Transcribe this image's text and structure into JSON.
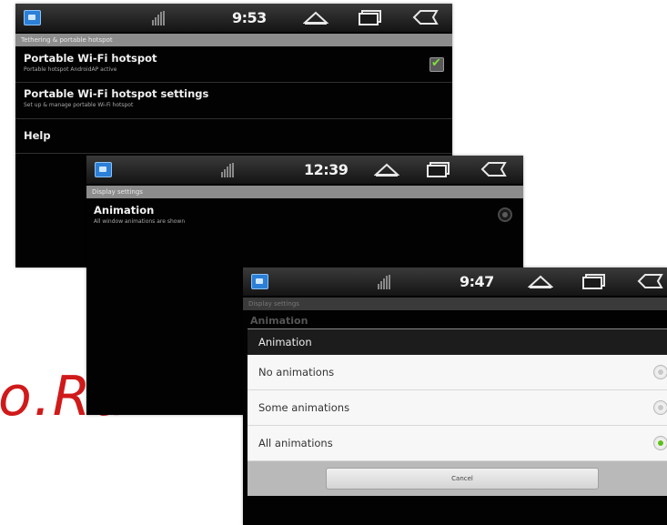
{
  "watermark": "o.Ru",
  "screen1": {
    "time": "9:53",
    "section_header": "Tethering & portable hotspot",
    "items": [
      {
        "title": "Portable Wi-Fi hotspot",
        "subtitle": "Portable hotspot AndroidAP active",
        "checked": true
      },
      {
        "title": "Portable Wi-Fi hotspot settings",
        "subtitle": "Set up & manage portable Wi-Fi hotspot"
      },
      {
        "title": "Help",
        "subtitle": ""
      }
    ]
  },
  "screen2": {
    "time": "12:39",
    "section_header": "Display settings",
    "item": {
      "title": "Animation",
      "subtitle": "All window animations are shown"
    }
  },
  "screen3": {
    "time": "9:47",
    "section_header": "Display settings",
    "background_item": "Animation",
    "dialog": {
      "title": "Animation",
      "options": [
        {
          "label": "No animations",
          "selected": false
        },
        {
          "label": "Some animations",
          "selected": false
        },
        {
          "label": "All animations",
          "selected": true
        }
      ],
      "cancel_label": "Cancel"
    }
  },
  "icons": [
    "app-icon",
    "signal-icon",
    "home-icon",
    "recent-apps-icon",
    "back-icon",
    "checkbox-icon",
    "radio-icon"
  ],
  "colors": {
    "accent_check": "#7ee23a",
    "radio_selected": "#5fbf1c",
    "watermark": "#d01a1a"
  }
}
